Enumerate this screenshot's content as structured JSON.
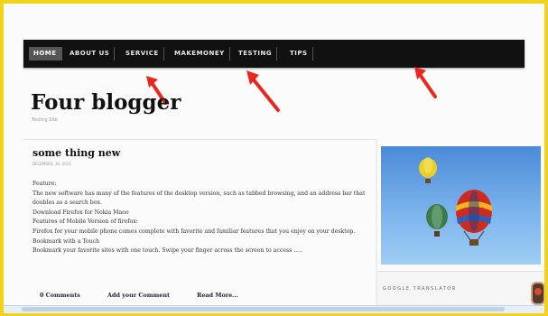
{
  "nav": {
    "items": [
      {
        "label": "HOME",
        "active": true
      },
      {
        "label": "ABOUT US",
        "active": false
      },
      {
        "label": "SERVICE",
        "active": false
      },
      {
        "label": "MAKEMONEY",
        "active": false
      },
      {
        "label": "TESTING",
        "active": false
      },
      {
        "label": "TIPS",
        "active": false
      }
    ]
  },
  "site": {
    "title": "Four blogger",
    "tagline": "Testing Site"
  },
  "post": {
    "title": "some thing new",
    "date": "DECEMBER, 30, 2011",
    "paragraphs": [
      "Feature:",
      "The new software has many of the features of the desktop version, such as tabbed browsing, and an address bar that doubles as a search box.",
      "Download Firefox for Nokia Maoo",
      "Features of Mobile Version of firefox:",
      "Firefox for your mobile phone comes complete with favorite and familiar features that you enjoy on your desktop.",
      "Bookmark with a Touch",
      "Bookmark your favorite sites with one touch. Swipe your finger across the screen to access ....."
    ],
    "actions": {
      "comments": "0 Comments",
      "add_comment": "Add your Comment",
      "read_more": "Read More..."
    }
  },
  "sidebar": {
    "widget_title": "GOOGLE TRANSLATOR"
  },
  "colors": {
    "frame_border": "#f3d21a",
    "nav_bg": "#111111",
    "arrow": "#e8281e"
  }
}
